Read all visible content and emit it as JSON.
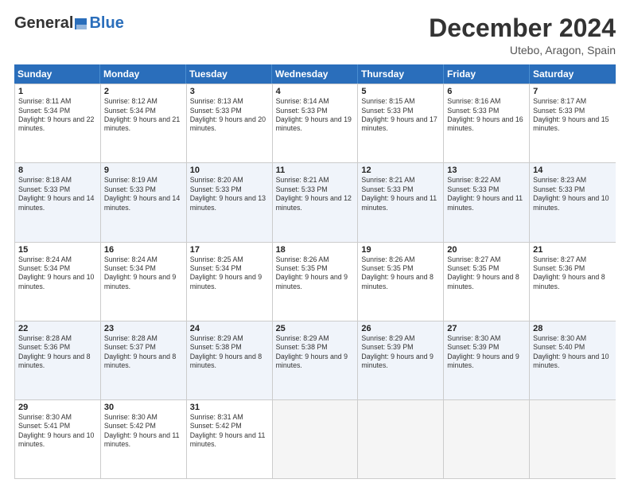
{
  "logo": {
    "general": "General",
    "blue": "Blue"
  },
  "header": {
    "month": "December 2024",
    "location": "Utebo, Aragon, Spain"
  },
  "days": [
    "Sunday",
    "Monday",
    "Tuesday",
    "Wednesday",
    "Thursday",
    "Friday",
    "Saturday"
  ],
  "weeks": [
    [
      {
        "day": "1",
        "sunrise": "Sunrise: 8:11 AM",
        "sunset": "Sunset: 5:34 PM",
        "daylight": "Daylight: 9 hours and 22 minutes."
      },
      {
        "day": "2",
        "sunrise": "Sunrise: 8:12 AM",
        "sunset": "Sunset: 5:34 PM",
        "daylight": "Daylight: 9 hours and 21 minutes."
      },
      {
        "day": "3",
        "sunrise": "Sunrise: 8:13 AM",
        "sunset": "Sunset: 5:33 PM",
        "daylight": "Daylight: 9 hours and 20 minutes."
      },
      {
        "day": "4",
        "sunrise": "Sunrise: 8:14 AM",
        "sunset": "Sunset: 5:33 PM",
        "daylight": "Daylight: 9 hours and 19 minutes."
      },
      {
        "day": "5",
        "sunrise": "Sunrise: 8:15 AM",
        "sunset": "Sunset: 5:33 PM",
        "daylight": "Daylight: 9 hours and 17 minutes."
      },
      {
        "day": "6",
        "sunrise": "Sunrise: 8:16 AM",
        "sunset": "Sunset: 5:33 PM",
        "daylight": "Daylight: 9 hours and 16 minutes."
      },
      {
        "day": "7",
        "sunrise": "Sunrise: 8:17 AM",
        "sunset": "Sunset: 5:33 PM",
        "daylight": "Daylight: 9 hours and 15 minutes."
      }
    ],
    [
      {
        "day": "8",
        "sunrise": "Sunrise: 8:18 AM",
        "sunset": "Sunset: 5:33 PM",
        "daylight": "Daylight: 9 hours and 14 minutes."
      },
      {
        "day": "9",
        "sunrise": "Sunrise: 8:19 AM",
        "sunset": "Sunset: 5:33 PM",
        "daylight": "Daylight: 9 hours and 14 minutes."
      },
      {
        "day": "10",
        "sunrise": "Sunrise: 8:20 AM",
        "sunset": "Sunset: 5:33 PM",
        "daylight": "Daylight: 9 hours and 13 minutes."
      },
      {
        "day": "11",
        "sunrise": "Sunrise: 8:21 AM",
        "sunset": "Sunset: 5:33 PM",
        "daylight": "Daylight: 9 hours and 12 minutes."
      },
      {
        "day": "12",
        "sunrise": "Sunrise: 8:21 AM",
        "sunset": "Sunset: 5:33 PM",
        "daylight": "Daylight: 9 hours and 11 minutes."
      },
      {
        "day": "13",
        "sunrise": "Sunrise: 8:22 AM",
        "sunset": "Sunset: 5:33 PM",
        "daylight": "Daylight: 9 hours and 11 minutes."
      },
      {
        "day": "14",
        "sunrise": "Sunrise: 8:23 AM",
        "sunset": "Sunset: 5:33 PM",
        "daylight": "Daylight: 9 hours and 10 minutes."
      }
    ],
    [
      {
        "day": "15",
        "sunrise": "Sunrise: 8:24 AM",
        "sunset": "Sunset: 5:34 PM",
        "daylight": "Daylight: 9 hours and 10 minutes."
      },
      {
        "day": "16",
        "sunrise": "Sunrise: 8:24 AM",
        "sunset": "Sunset: 5:34 PM",
        "daylight": "Daylight: 9 hours and 9 minutes."
      },
      {
        "day": "17",
        "sunrise": "Sunrise: 8:25 AM",
        "sunset": "Sunset: 5:34 PM",
        "daylight": "Daylight: 9 hours and 9 minutes."
      },
      {
        "day": "18",
        "sunrise": "Sunrise: 8:26 AM",
        "sunset": "Sunset: 5:35 PM",
        "daylight": "Daylight: 9 hours and 9 minutes."
      },
      {
        "day": "19",
        "sunrise": "Sunrise: 8:26 AM",
        "sunset": "Sunset: 5:35 PM",
        "daylight": "Daylight: 9 hours and 8 minutes."
      },
      {
        "day": "20",
        "sunrise": "Sunrise: 8:27 AM",
        "sunset": "Sunset: 5:35 PM",
        "daylight": "Daylight: 9 hours and 8 minutes."
      },
      {
        "day": "21",
        "sunrise": "Sunrise: 8:27 AM",
        "sunset": "Sunset: 5:36 PM",
        "daylight": "Daylight: 9 hours and 8 minutes."
      }
    ],
    [
      {
        "day": "22",
        "sunrise": "Sunrise: 8:28 AM",
        "sunset": "Sunset: 5:36 PM",
        "daylight": "Daylight: 9 hours and 8 minutes."
      },
      {
        "day": "23",
        "sunrise": "Sunrise: 8:28 AM",
        "sunset": "Sunset: 5:37 PM",
        "daylight": "Daylight: 9 hours and 8 minutes."
      },
      {
        "day": "24",
        "sunrise": "Sunrise: 8:29 AM",
        "sunset": "Sunset: 5:38 PM",
        "daylight": "Daylight: 9 hours and 8 minutes."
      },
      {
        "day": "25",
        "sunrise": "Sunrise: 8:29 AM",
        "sunset": "Sunset: 5:38 PM",
        "daylight": "Daylight: 9 hours and 9 minutes."
      },
      {
        "day": "26",
        "sunrise": "Sunrise: 8:29 AM",
        "sunset": "Sunset: 5:39 PM",
        "daylight": "Daylight: 9 hours and 9 minutes."
      },
      {
        "day": "27",
        "sunrise": "Sunrise: 8:30 AM",
        "sunset": "Sunset: 5:39 PM",
        "daylight": "Daylight: 9 hours and 9 minutes."
      },
      {
        "day": "28",
        "sunrise": "Sunrise: 8:30 AM",
        "sunset": "Sunset: 5:40 PM",
        "daylight": "Daylight: 9 hours and 10 minutes."
      }
    ],
    [
      {
        "day": "29",
        "sunrise": "Sunrise: 8:30 AM",
        "sunset": "Sunset: 5:41 PM",
        "daylight": "Daylight: 9 hours and 10 minutes."
      },
      {
        "day": "30",
        "sunrise": "Sunrise: 8:30 AM",
        "sunset": "Sunset: 5:42 PM",
        "daylight": "Daylight: 9 hours and 11 minutes."
      },
      {
        "day": "31",
        "sunrise": "Sunrise: 8:31 AM",
        "sunset": "Sunset: 5:42 PM",
        "daylight": "Daylight: 9 hours and 11 minutes."
      },
      null,
      null,
      null,
      null
    ]
  ],
  "altRows": [
    1,
    3
  ]
}
